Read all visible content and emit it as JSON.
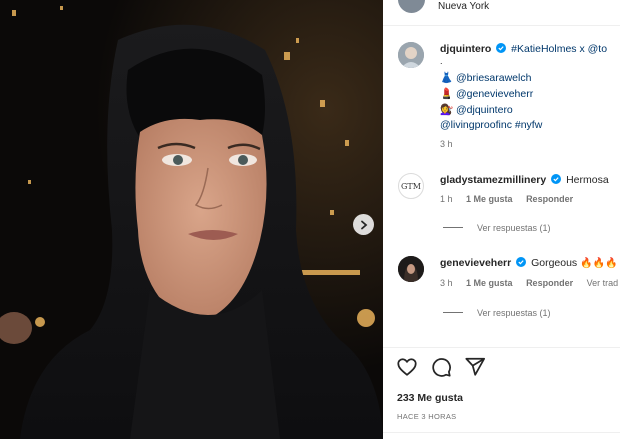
{
  "post": {
    "location": "Nueva York",
    "image_alt": "Katie Holmes wearing black hood",
    "likes": "233 Me gusta",
    "time_ago": "HACE 3 HORAS"
  },
  "caption": {
    "username": "djquintero",
    "first_line_text": "#KatieHolmes x @to",
    "dot": ".",
    "line1_mention": "@briesarawelch",
    "line2_mention": "@genevieveherr",
    "line3_mention": "@djquintero",
    "line4": "@livingproofinc #nyfw",
    "time": "3 h"
  },
  "comments": [
    {
      "username": "gladystamezmillinery",
      "text": "Hermosa",
      "time": "1 h",
      "likes": "1 Me gusta",
      "reply": "Responder",
      "view_replies": "Ver respuestas (1)"
    },
    {
      "username": "genevieveherr",
      "text": "Gorgeous",
      "time": "3 h",
      "likes": "1 Me gusta",
      "reply": "Responder",
      "translate": "Ver trad",
      "view_replies": "Ver respuestas (1)"
    }
  ],
  "colors": {
    "verified": "#0095f6",
    "link": "#00376b",
    "muted": "#737373"
  },
  "icons": [
    "heart-icon",
    "comment-icon",
    "share-icon",
    "verified-icon",
    "chevron-right-icon",
    "fire-icon"
  ]
}
